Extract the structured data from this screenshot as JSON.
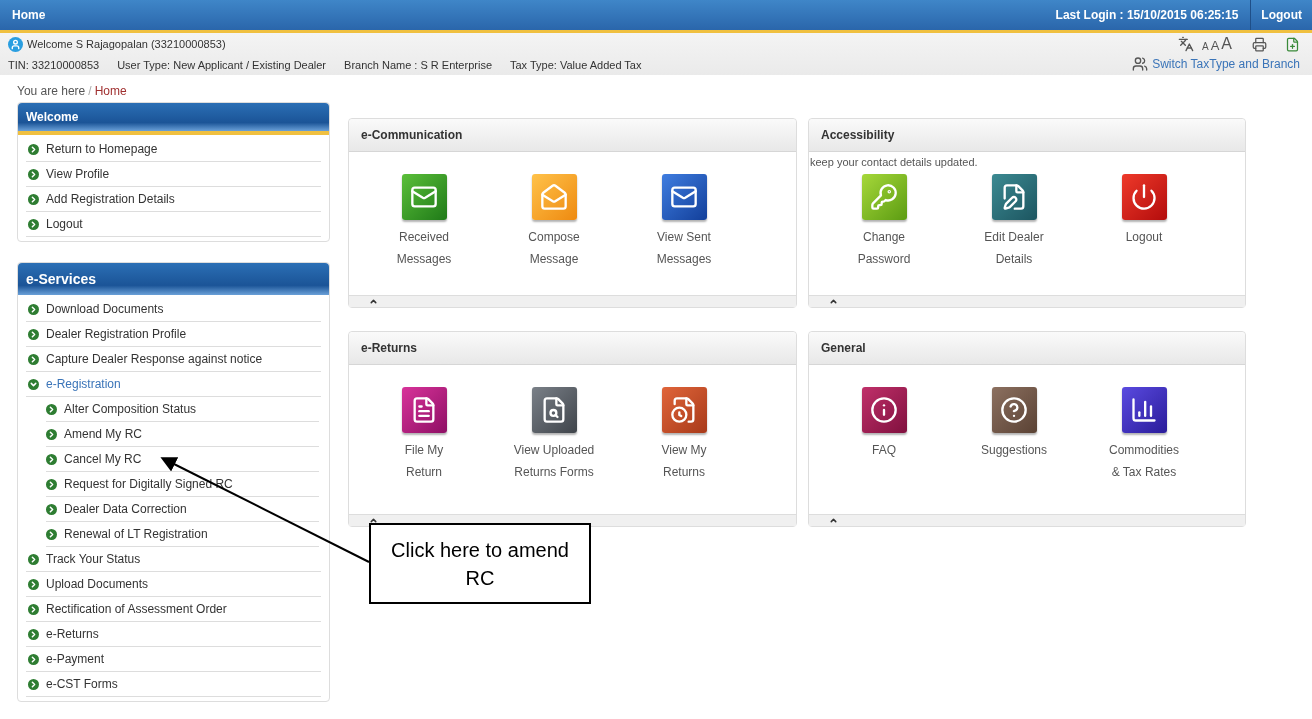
{
  "top_bar": {
    "title": "Home",
    "last_login": "Last Login : 15/10/2015 06:25:15",
    "logout": "Logout"
  },
  "info_bar": {
    "welcome": "Welcome S Rajagopalan (33210000853)",
    "tin": "TIN: 33210000853",
    "user_type": "User Type: New Applicant / Existing Dealer",
    "branch": "Branch Name : S R Enterprise",
    "tax_type": "Tax Type: Value Added Tax",
    "font_sizes": [
      "A",
      "A",
      "A"
    ],
    "switch_link": "Switch TaxType and Branch"
  },
  "breadcrumb": {
    "prefix": "You are here",
    "separator": "/",
    "current": "Home"
  },
  "sidebar": [
    {
      "title": "Welcome",
      "items": [
        {
          "label": "Return to Homepage"
        },
        {
          "label": "View Profile"
        },
        {
          "label": "Add Registration Details"
        },
        {
          "label": "Logout"
        }
      ]
    },
    {
      "title": "e-Services",
      "items": [
        {
          "label": "Download Documents"
        },
        {
          "label": "Dealer Registration Profile"
        },
        {
          "label": "Capture Dealer Response against notice"
        },
        {
          "label": "e-Registration",
          "expanded": true,
          "children": [
            {
              "label": "Alter Composition Status"
            },
            {
              "label": "Amend My RC"
            },
            {
              "label": "Cancel My RC"
            },
            {
              "label": "Request for Digitally Signed RC"
            },
            {
              "label": "Dealer Data Correction"
            },
            {
              "label": "Renewal of LT Registration"
            }
          ]
        },
        {
          "label": "Track Your Status"
        },
        {
          "label": "Upload Documents"
        },
        {
          "label": "Rectification of Assessment Order"
        },
        {
          "label": "e-Returns"
        },
        {
          "label": "e-Payment"
        },
        {
          "label": "e-CST Forms"
        }
      ]
    }
  ],
  "panels": [
    {
      "title": "e-Communication",
      "tiles": [
        {
          "kind": "received",
          "label": [
            "Received",
            "Messages"
          ]
        },
        {
          "kind": "compose",
          "label": [
            "Compose",
            "Message"
          ]
        },
        {
          "kind": "sent",
          "label": [
            "View Sent",
            "Messages"
          ]
        }
      ]
    },
    {
      "title": "Accessibility",
      "note": "keep your contact details updated.",
      "tiles": [
        {
          "kind": "password",
          "label": [
            "Change",
            "Password"
          ]
        },
        {
          "kind": "edit",
          "label": [
            "Edit Dealer",
            "Details"
          ]
        },
        {
          "kind": "logout",
          "label": [
            "Logout"
          ]
        }
      ]
    },
    {
      "title": "e-Returns",
      "tiles": [
        {
          "kind": "file",
          "label": [
            "File My",
            "Return"
          ]
        },
        {
          "kind": "uploaded",
          "label": [
            "View Uploaded",
            "Returns Forms"
          ]
        },
        {
          "kind": "view",
          "label": [
            "View My",
            "Returns"
          ]
        }
      ]
    },
    {
      "title": "General",
      "tiles": [
        {
          "kind": "faq",
          "label": [
            "FAQ"
          ]
        },
        {
          "kind": "suggest",
          "label": [
            "Suggestions"
          ]
        },
        {
          "kind": "rates",
          "label": [
            "Commodities",
            "& Tax Rates"
          ]
        }
      ]
    }
  ],
  "callout": {
    "text": "Click here to amend RC"
  }
}
